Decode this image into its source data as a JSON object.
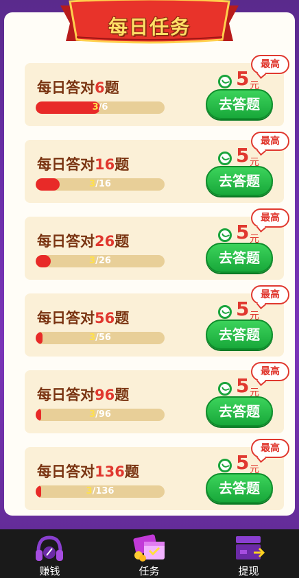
{
  "banner": {
    "title": "每日任务"
  },
  "tasks": [
    {
      "prefix": "每日答对",
      "target": "6",
      "suffix": "题",
      "current": "3",
      "total_text": "/6",
      "progress": 0.5,
      "reward_amount": "5",
      "reward_unit": "元",
      "badge": "最高",
      "button": "去答题"
    },
    {
      "prefix": "每日答对",
      "target": "16",
      "suffix": "题",
      "current": "3",
      "total_text": "/16",
      "progress": 0.1875,
      "reward_amount": "5",
      "reward_unit": "元",
      "badge": "最高",
      "button": "去答题"
    },
    {
      "prefix": "每日答对",
      "target": "26",
      "suffix": "题",
      "current": "3",
      "total_text": "/26",
      "progress": 0.115,
      "reward_amount": "5",
      "reward_unit": "元",
      "badge": "最高",
      "button": "去答题"
    },
    {
      "prefix": "每日答对",
      "target": "56",
      "suffix": "题",
      "current": "3",
      "total_text": "/56",
      "progress": 0.054,
      "reward_amount": "5",
      "reward_unit": "元",
      "badge": "最高",
      "button": "去答题"
    },
    {
      "prefix": "每日答对",
      "target": "96",
      "suffix": "题",
      "current": "3",
      "total_text": "/96",
      "progress": 0.031,
      "reward_amount": "5",
      "reward_unit": "元",
      "badge": "最高",
      "button": "去答题"
    },
    {
      "prefix": "每日答对",
      "target": "136",
      "suffix": "题",
      "current": "3",
      "total_text": "/136",
      "progress": 0.022,
      "reward_amount": "5",
      "reward_unit": "元",
      "badge": "最高",
      "button": "去答题"
    }
  ],
  "tabbar": {
    "items": [
      {
        "label": "赚钱",
        "icon": "headphones-icon"
      },
      {
        "label": "任务",
        "icon": "gift-bag-icon"
      },
      {
        "label": "提现",
        "icon": "wallet-icon"
      }
    ]
  },
  "colors": {
    "accent_red": "#e0382f",
    "button_green": "#18a83a",
    "card_bg": "#fbf0d7",
    "title_brown": "#7a3412",
    "tabbar_bg": "#1a1a1a"
  }
}
